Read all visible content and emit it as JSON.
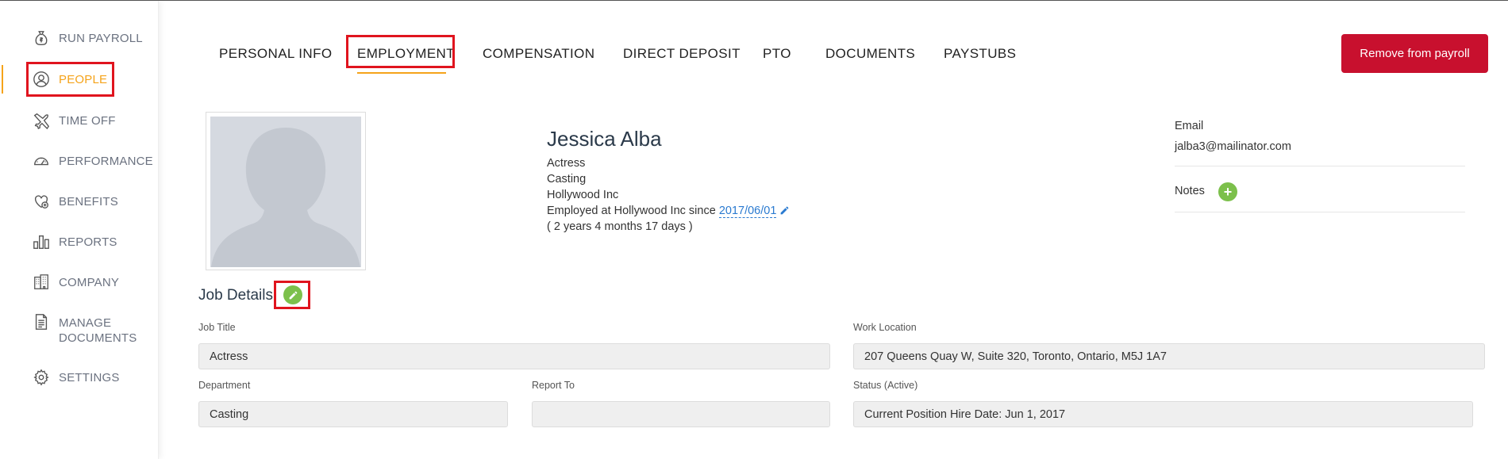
{
  "sidebar": {
    "items": [
      {
        "label": "RUN PAYROLL",
        "icon": "money-bag-icon"
      },
      {
        "label": "PEOPLE",
        "icon": "person-icon",
        "active": true
      },
      {
        "label": "TIME OFF",
        "icon": "airplane-icon"
      },
      {
        "label": "PERFORMANCE",
        "icon": "gauge-icon"
      },
      {
        "label": "BENEFITS",
        "icon": "heart-icon"
      },
      {
        "label": "REPORTS",
        "icon": "bar-chart-icon"
      },
      {
        "label": "COMPANY",
        "icon": "building-icon"
      },
      {
        "label": "MANAGE DOCUMENTS",
        "line1": "MANAGE",
        "line2": "DOCUMENTS",
        "icon": "document-icon"
      },
      {
        "label": "SETTINGS",
        "icon": "gear-icon"
      }
    ]
  },
  "tabs": [
    {
      "label": "PERSONAL INFO"
    },
    {
      "label": "EMPLOYMENT",
      "active": true
    },
    {
      "label": "COMPENSATION"
    },
    {
      "label": "DIRECT DEPOSIT"
    },
    {
      "label": "PTO"
    },
    {
      "label": "DOCUMENTS"
    },
    {
      "label": "PAYSTUBS"
    }
  ],
  "header": {
    "remove_label": "Remove from payroll"
  },
  "profile": {
    "name": "Jessica Alba",
    "title": "Actress",
    "department": "Casting",
    "company": "Hollywood Inc",
    "employed_prefix": "Employed at Hollywood Inc since",
    "employed_date": "2017/06/01",
    "tenure": "( 2 years 4 months 17 days )"
  },
  "contact": {
    "email_label": "Email",
    "email": "jalba3@mailinator.com",
    "notes_label": "Notes",
    "add_symbol": "+"
  },
  "job_details": {
    "title": "Job Details",
    "job_title_label": "Job Title",
    "job_title": "Actress",
    "work_location_label": "Work Location",
    "work_location": "207 Queens Quay W, Suite 320, Toronto, Ontario, M5J 1A7",
    "department_label": "Department",
    "department": "Casting",
    "report_to_label": "Report To",
    "report_to": "",
    "status_label": "Status (Active)",
    "status_value": "Current Position Hire Date: Jun 1, 2017"
  },
  "colors": {
    "accent": "#f5a31a",
    "danger": "#c8102e",
    "highlight": "#e0141e",
    "success": "#7cc04b",
    "link": "#2a7ad0"
  }
}
